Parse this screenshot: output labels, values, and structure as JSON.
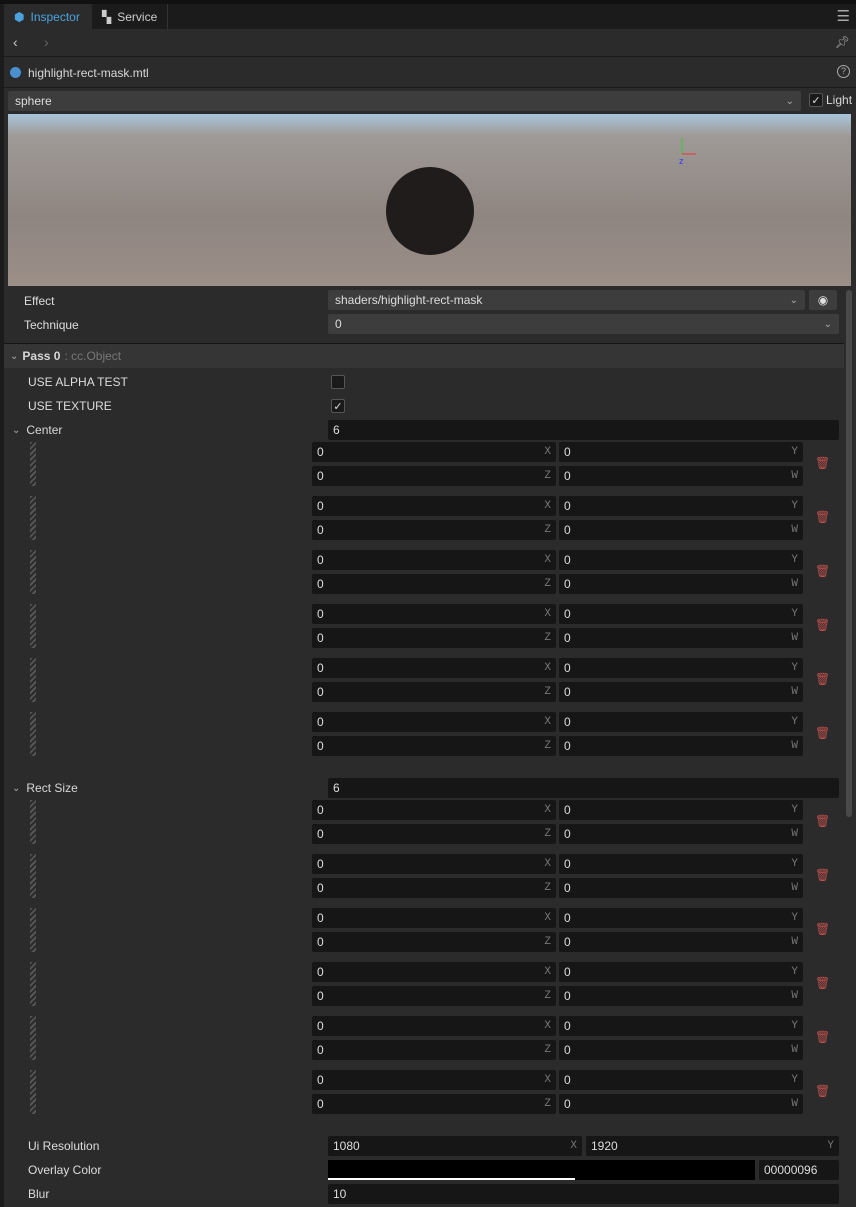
{
  "tabs": [
    {
      "label": "Inspector",
      "icon": "cube-icon"
    },
    {
      "label": "Service",
      "icon": "grid-icon"
    }
  ],
  "file": {
    "name": "highlight-rect-mask.mtl"
  },
  "preview": {
    "mesh": "sphere",
    "light_label": "Light",
    "light_checked": true
  },
  "effect": {
    "label": "Effect",
    "value": "shaders/highlight-rect-mask"
  },
  "technique": {
    "label": "Technique",
    "value": "0"
  },
  "pass": {
    "title": "Pass 0",
    "type": ": cc.Object"
  },
  "props": {
    "use_alpha_test": {
      "label": "USE ALPHA TEST",
      "checked": false
    },
    "use_texture": {
      "label": "USE TEXTURE",
      "checked": true
    },
    "center": {
      "label": "Center",
      "count": "6",
      "items": [
        [
          "0",
          "0",
          "0",
          "0"
        ],
        [
          "0",
          "0",
          "0",
          "0"
        ],
        [
          "0",
          "0",
          "0",
          "0"
        ],
        [
          "0",
          "0",
          "0",
          "0"
        ],
        [
          "0",
          "0",
          "0",
          "0"
        ],
        [
          "0",
          "0",
          "0",
          "0"
        ]
      ]
    },
    "rect_size": {
      "label": "Rect Size",
      "count": "6",
      "items": [
        [
          "0",
          "0",
          "0",
          "0"
        ],
        [
          "0",
          "0",
          "0",
          "0"
        ],
        [
          "0",
          "0",
          "0",
          "0"
        ],
        [
          "0",
          "0",
          "0",
          "0"
        ],
        [
          "0",
          "0",
          "0",
          "0"
        ],
        [
          "0",
          "0",
          "0",
          "0"
        ]
      ]
    },
    "ui_resolution": {
      "label": "Ui Resolution",
      "x": "1080",
      "y": "1920"
    },
    "overlay_color": {
      "label": "Overlay Color",
      "hex": "00000096",
      "color": "#000000",
      "alpha_percent": 59
    },
    "blur": {
      "label": "Blur",
      "value": "10"
    }
  },
  "axes": [
    "X",
    "Y",
    "Z",
    "W"
  ]
}
